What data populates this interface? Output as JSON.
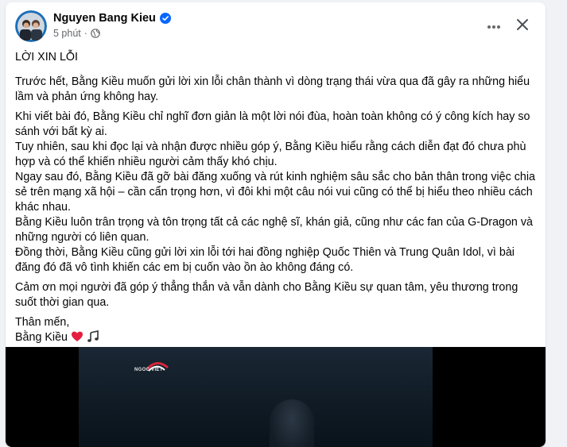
{
  "post": {
    "author": "Nguyen Bang Kieu",
    "timestamp": "5 phút",
    "separator": "·",
    "privacy_icon": "globe-icon",
    "verified_icon": "verified-badge-icon",
    "more_icon": "more-options-icon",
    "close_icon": "close-icon"
  },
  "content": {
    "title": "LỜI XIN LỖI",
    "p1": "Trước hết, Bằng Kiều muốn gửi lời xin lỗi chân thành vì dòng trạng thái vừa qua đã gây ra những hiểu lầm và phản ứng không hay.",
    "p2": "Khi viết bài đó, Bằng Kiều chỉ nghĩ đơn giản là một lời nói đùa, hoàn toàn không có ý công kích hay so sánh với bất kỳ ai.",
    "p3": "Tuy nhiên, sau khi đọc lại và nhận được nhiều góp ý, Bằng Kiều hiểu rằng cách diễn đạt đó chưa phù hợp và có thể khiến nhiều người cảm thấy khó chịu.",
    "p4": "Ngay sau đó, Bằng Kiều đã gỡ bài đăng xuống và rút kinh nghiệm sâu sắc cho bản thân trong việc chia sẻ trên mạng xã hội – cần cẩn trọng hơn, vì đôi khi một câu nói vui cũng có thể bị hiểu theo nhiều cách khác nhau.",
    "p5": "Bằng Kiều luôn trân trọng và tôn trọng tất cả các nghệ sĩ, khán giả, cũng như các fan của G-Dragon và những người có liên quan.",
    "p6": "Đồng thời, Bằng Kiều cũng gửi lời xin lỗi tới hai đồng nghiệp Quốc Thiên và Trung Quân Idol, vì bài đăng đó đã vô tình khiến các em bị cuốn vào ồn ào không đáng có.",
    "p7": "Cảm ơn mọi người đã góp ý thẳng thắn và vẫn dành cho Bằng Kiều sự quan tâm, yêu thương trong suốt thời gian qua.",
    "closing": "Thân mến,",
    "signature": "Bằng Kiều",
    "signature_icons": [
      "heart-icon",
      "music-note-icon"
    ]
  },
  "media": {
    "watermark_text": "NGOC VIET"
  },
  "colors": {
    "verified": "#0866ff",
    "secondary_text": "#65676b",
    "heart": "#e41e3f"
  }
}
